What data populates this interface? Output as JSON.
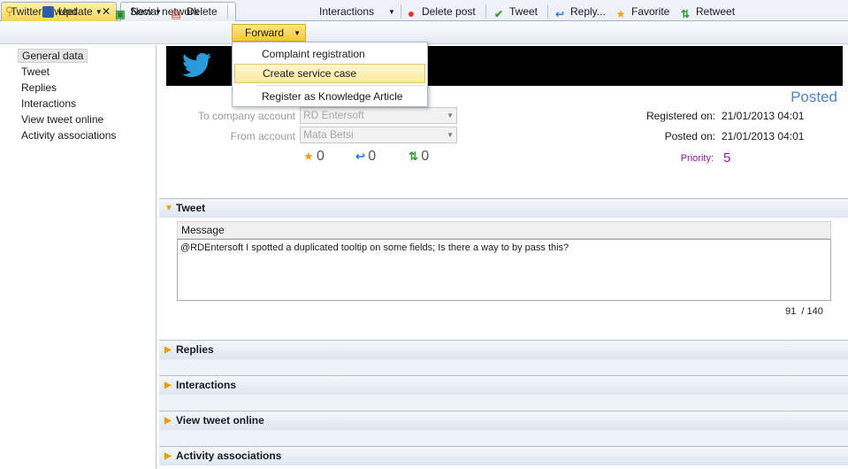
{
  "tabs": [
    {
      "label": "Twitter - tweet",
      "close": "✕"
    },
    {
      "label": "Social network activity"
    }
  ],
  "toolbar": {
    "update": "Update",
    "new": "New",
    "delete": "Delete",
    "forward": "Forward",
    "interactions": "Interactions",
    "delete_post": "Delete post",
    "tweet": "Tweet",
    "reply": "Reply...",
    "favorite": "Favorite",
    "retweet": "Retweet"
  },
  "forward_menu": {
    "items": [
      "Complaint registration",
      "Create service case",
      "Register as Knowledge Article"
    ],
    "highlighted_index": 1
  },
  "sidebar": {
    "items": [
      "General data",
      "Tweet",
      "Replies",
      "Interactions",
      "View tweet online",
      "Activity associations"
    ],
    "selected_index": 0
  },
  "header": {
    "status": "Posted"
  },
  "form": {
    "to_company_label": "To company account",
    "to_company_value": "RD Entersoft",
    "from_account_label": "From account",
    "from_account_value": "Mata Betsi",
    "favorites_count": "0",
    "replies_count": "0",
    "retweets_count": "0",
    "registered_label": "Registered on:",
    "registered_value": "21/01/2013 04:01",
    "posted_label": "Posted on:",
    "posted_value": "21/01/2013 04:01",
    "priority_label": "Priority:",
    "priority_value": "5"
  },
  "tweet_section": {
    "title": "Tweet",
    "message_label": "Message",
    "message_text": "@RDEntersoft I spotted a duplicated tooltip on some fields; Is there a way to by pass this?",
    "char_count": "91",
    "char_max": "/ 140"
  },
  "sections": {
    "replies": "Replies",
    "interactions": "Interactions",
    "view_online": "View tweet online",
    "activity": "Activity associations"
  },
  "colors": {
    "accent_tab": "#f5d55a",
    "status_blue": "#4a86c5",
    "priority_purple": "#8b1a9a",
    "section_arrow": "#e8a000"
  },
  "icons": [
    "twitter-bird-icon",
    "pin-icon",
    "save-icon",
    "new-icon",
    "delete-icon",
    "delete-post-icon",
    "check-icon",
    "reply-icon",
    "star-icon",
    "retweet-icon"
  ]
}
